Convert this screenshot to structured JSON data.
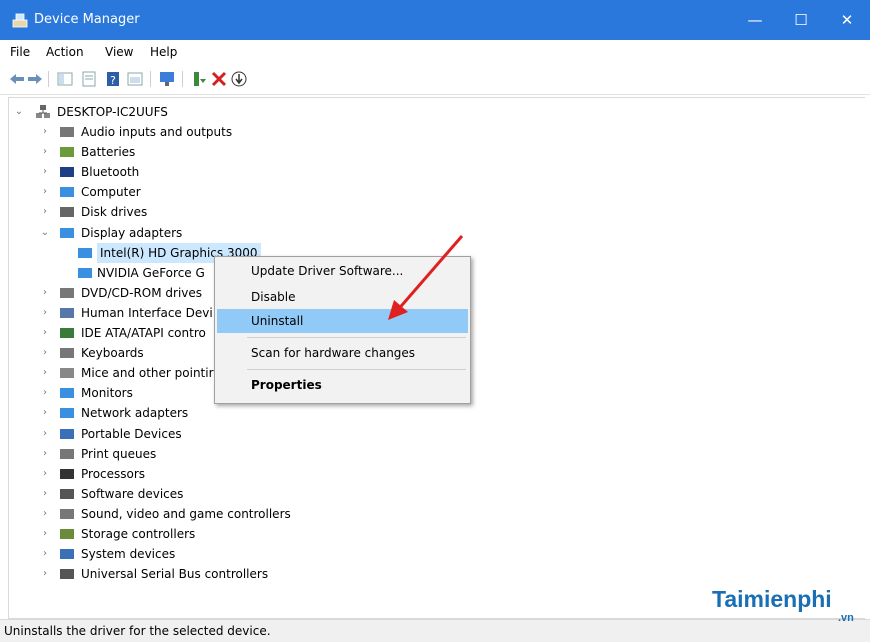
{
  "window": {
    "title": "Device Manager",
    "minimize": "—",
    "maximize": "☐",
    "close": "✕"
  },
  "menu": [
    "File",
    "Action",
    "View",
    "Help"
  ],
  "tree": {
    "root": "DESKTOP-IC2UUFS",
    "categories": [
      {
        "label": "Audio inputs and outputs",
        "icon": "speaker-icon",
        "expanded": false
      },
      {
        "label": "Batteries",
        "icon": "battery-icon",
        "expanded": false
      },
      {
        "label": "Bluetooth",
        "icon": "bluetooth-icon",
        "expanded": false
      },
      {
        "label": "Computer",
        "icon": "computer-icon",
        "expanded": false
      },
      {
        "label": "Disk drives",
        "icon": "disk-drive-icon",
        "expanded": false
      },
      {
        "label": "Display adapters",
        "icon": "display-adapter-icon",
        "expanded": true
      },
      {
        "label": "Intel(R) HD Graphics 3000",
        "icon": "display-adapter-icon",
        "child": true,
        "selected": true
      },
      {
        "label": "NVIDIA GeForce G",
        "icon": "display-adapter-icon",
        "child": true
      },
      {
        "label": "DVD/CD-ROM drives",
        "icon": "dvd-drive-icon",
        "expanded": false
      },
      {
        "label": "Human Interface Devi",
        "icon": "hid-icon",
        "expanded": false
      },
      {
        "label": "IDE ATA/ATAPI contro",
        "icon": "ide-controller-icon",
        "expanded": false
      },
      {
        "label": "Keyboards",
        "icon": "keyboard-icon",
        "expanded": false
      },
      {
        "label": "Mice and other pointir",
        "icon": "mouse-icon",
        "expanded": false
      },
      {
        "label": "Monitors",
        "icon": "monitor-icon",
        "expanded": false
      },
      {
        "label": "Network adapters",
        "icon": "network-adapter-icon",
        "expanded": false
      },
      {
        "label": "Portable Devices",
        "icon": "portable-device-icon",
        "expanded": false
      },
      {
        "label": "Print queues",
        "icon": "printer-icon",
        "expanded": false
      },
      {
        "label": "Processors",
        "icon": "processor-icon",
        "expanded": false
      },
      {
        "label": "Software devices",
        "icon": "software-device-icon",
        "expanded": false
      },
      {
        "label": "Sound, video and game controllers",
        "icon": "speaker-icon",
        "expanded": false
      },
      {
        "label": "Storage controllers",
        "icon": "storage-controller-icon",
        "expanded": false
      },
      {
        "label": "System devices",
        "icon": "system-device-icon",
        "expanded": false
      },
      {
        "label": "Universal Serial Bus controllers",
        "icon": "usb-icon",
        "expanded": false
      }
    ]
  },
  "context_menu": {
    "items": [
      "Update Driver Software...",
      "Disable",
      "Uninstall",
      "Scan for hardware changes",
      "Properties"
    ],
    "highlighted": "Uninstall"
  },
  "status": "Uninstalls the driver for the selected device.",
  "watermark": {
    "brand": "Taimienphi",
    "tld": ".vn"
  },
  "colors": {
    "titlebar": "#2b78dc",
    "selection": "#cce8ff",
    "menu_highlight": "#91c9f7",
    "arrow": "#e02020"
  }
}
